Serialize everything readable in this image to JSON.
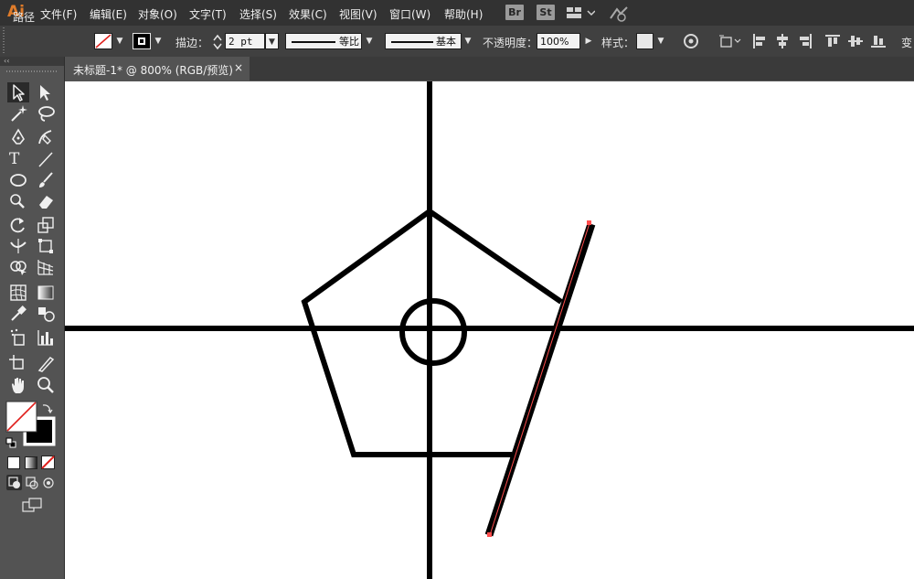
{
  "app": {
    "logo": "Ai"
  },
  "menu": [
    "文件(F)",
    "编辑(E)",
    "对象(O)",
    "文字(T)",
    "选择(S)",
    "效果(C)",
    "视图(V)",
    "窗口(W)",
    "帮助(H)"
  ],
  "bridge": {
    "br": "Br",
    "st": "St"
  },
  "control_bar": {
    "object_type": "路径",
    "stroke_label": "描边：",
    "stroke_weight": "2 pt",
    "profile_label": "等比",
    "brush_label": "基本",
    "opacity_label": "不透明度：",
    "opacity_value": "100%",
    "style_label": "样式：",
    "transform_label": "变"
  },
  "toolbar": {
    "collapse_glyph": "‹‹"
  },
  "document": {
    "tab_title": "未标题-1* @ 800% (RGB/预览)",
    "close_glyph": "×"
  },
  "colors": {
    "canvas": "#ffffff",
    "stroke": "#000000",
    "selection": "#ff4d4d",
    "accent": "#e07c2a"
  }
}
